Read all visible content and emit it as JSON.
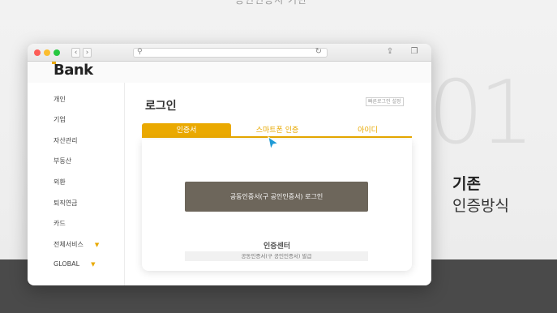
{
  "top_caption": "공인인증서 기반",
  "side_number": "01",
  "side_title": "기존",
  "side_subtitle": "인증방식",
  "browser": {
    "back_glyph": "‹",
    "forward_glyph": "›",
    "search_glyph": "⚲",
    "reload_glyph": "↻",
    "share_glyph": "⇪",
    "tabs_glyph": "❐",
    "icons": [
      "back-icon",
      "forward-icon",
      "search-icon",
      "reload-icon",
      "share-icon",
      "tabs-icon"
    ]
  },
  "logo": "Bank",
  "sidebar": {
    "items": [
      {
        "label": "개인"
      },
      {
        "label": "기업"
      },
      {
        "label": "자산관리"
      },
      {
        "label": "부동산"
      },
      {
        "label": "외환"
      },
      {
        "label": "퇴직연금"
      },
      {
        "label": "카드"
      },
      {
        "label": "전체서비스",
        "arrow": "▼"
      },
      {
        "label": "GLOBAL",
        "arrow": "▼"
      }
    ]
  },
  "main": {
    "title": "로그인",
    "quick_setting": "빠른로그인 설정",
    "tabs": [
      {
        "label": "인증서"
      },
      {
        "label": "스마트폰 인증"
      },
      {
        "label": "아이디"
      }
    ],
    "login_button": "공동인증서(구 공인인증서) 로그인",
    "center_title": "인증센터",
    "center_sub": "공동인증서(구 공인인증서) 발급"
  },
  "colors": {
    "accent": "#eaa900",
    "button": "#6d665b",
    "footer_band": "#4a4a4a",
    "cursor": "#1e9ad6"
  }
}
